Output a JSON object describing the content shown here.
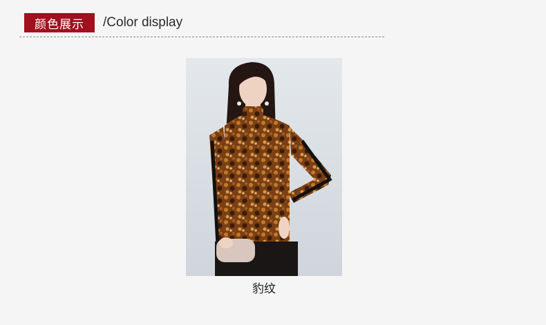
{
  "header": {
    "badge_label": "颜色展示",
    "subtitle": "/Color display"
  },
  "product": {
    "color_name": "豹纹"
  },
  "colors": {
    "badge_bg": "#a0101e",
    "page_bg": "#f5f5f5"
  }
}
